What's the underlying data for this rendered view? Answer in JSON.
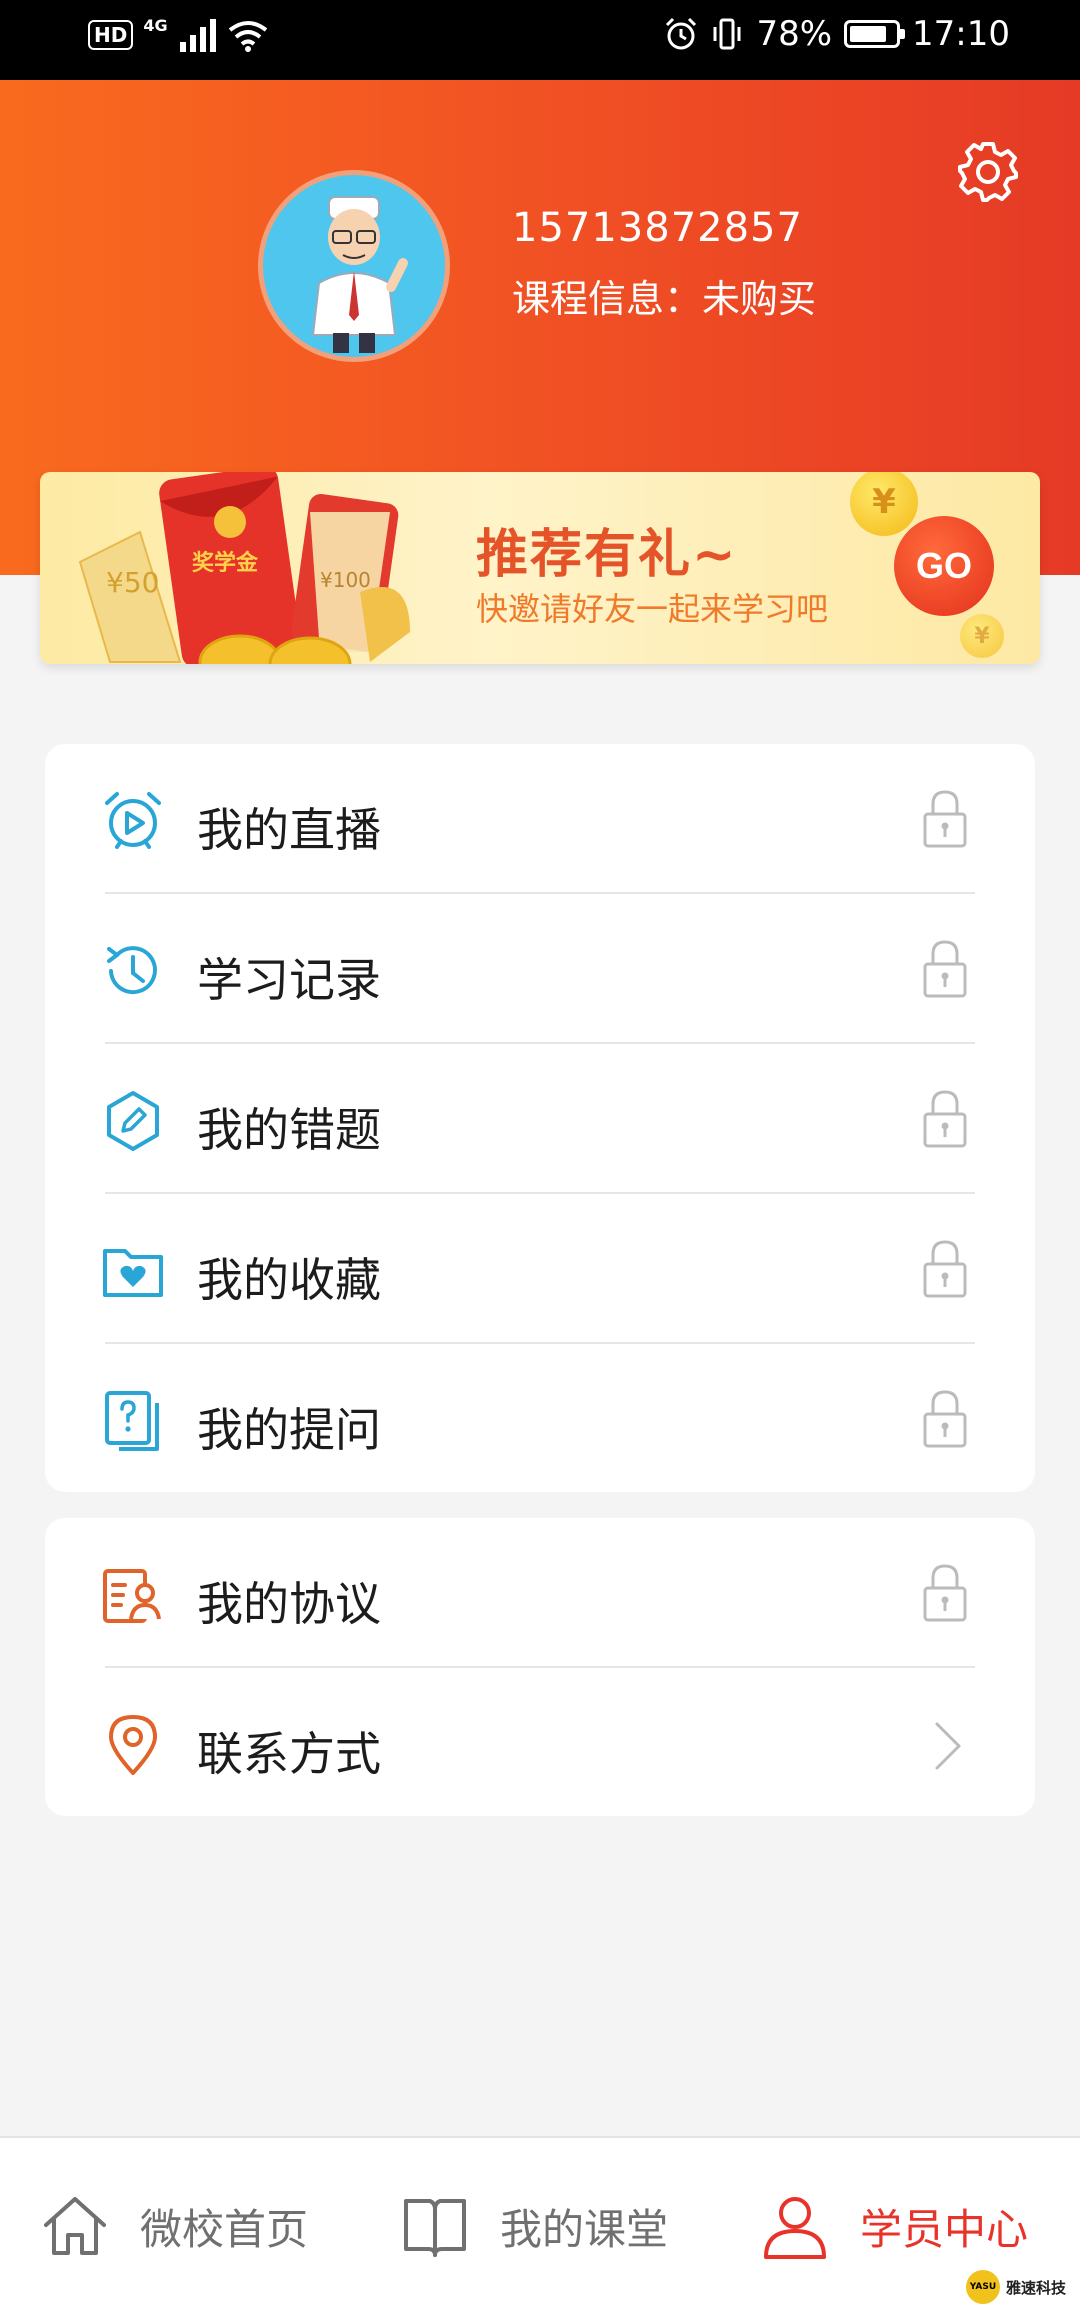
{
  "status_bar": {
    "hd": "HD",
    "network": "4G",
    "battery": "78%",
    "time": "17:10"
  },
  "profile": {
    "phone": "15713872857",
    "course_info": "课程信息：未购买"
  },
  "banner": {
    "title": "推荐有礼~",
    "subtitle": "快邀请好友一起来学习吧",
    "go_label": "GO",
    "envelope_label": "奖学金",
    "coupon_50": "¥50",
    "coupon_100": "¥100",
    "coin_symbol": "¥"
  },
  "menu_group_1": [
    {
      "label": "我的直播",
      "icon": "live-clock-icon",
      "accessory": "lock"
    },
    {
      "label": "学习记录",
      "icon": "history-icon",
      "accessory": "lock"
    },
    {
      "label": "我的错题",
      "icon": "edit-hexagon-icon",
      "accessory": "lock"
    },
    {
      "label": "我的收藏",
      "icon": "heart-folder-icon",
      "accessory": "lock"
    },
    {
      "label": "我的提问",
      "icon": "question-doc-icon",
      "accessory": "lock"
    }
  ],
  "menu_group_2": [
    {
      "label": "我的协议",
      "icon": "agreement-icon",
      "accessory": "lock"
    },
    {
      "label": "联系方式",
      "icon": "location-pin-icon",
      "accessory": "chevron"
    }
  ],
  "tabs": [
    {
      "label": "微校首页",
      "icon": "home-icon",
      "active": false
    },
    {
      "label": "我的课堂",
      "icon": "book-icon",
      "active": false
    },
    {
      "label": "学员中心",
      "icon": "user-icon",
      "active": true
    }
  ],
  "watermark": {
    "logo_text": "YASU",
    "text": "雅速科技"
  },
  "colors": {
    "header_start": "#f96a1e",
    "header_end": "#e53a26",
    "accent_blue": "#2aa6d6",
    "accent_orange": "#e0642a",
    "active_tab": "#e8332a",
    "inactive_tab": "#707070"
  }
}
